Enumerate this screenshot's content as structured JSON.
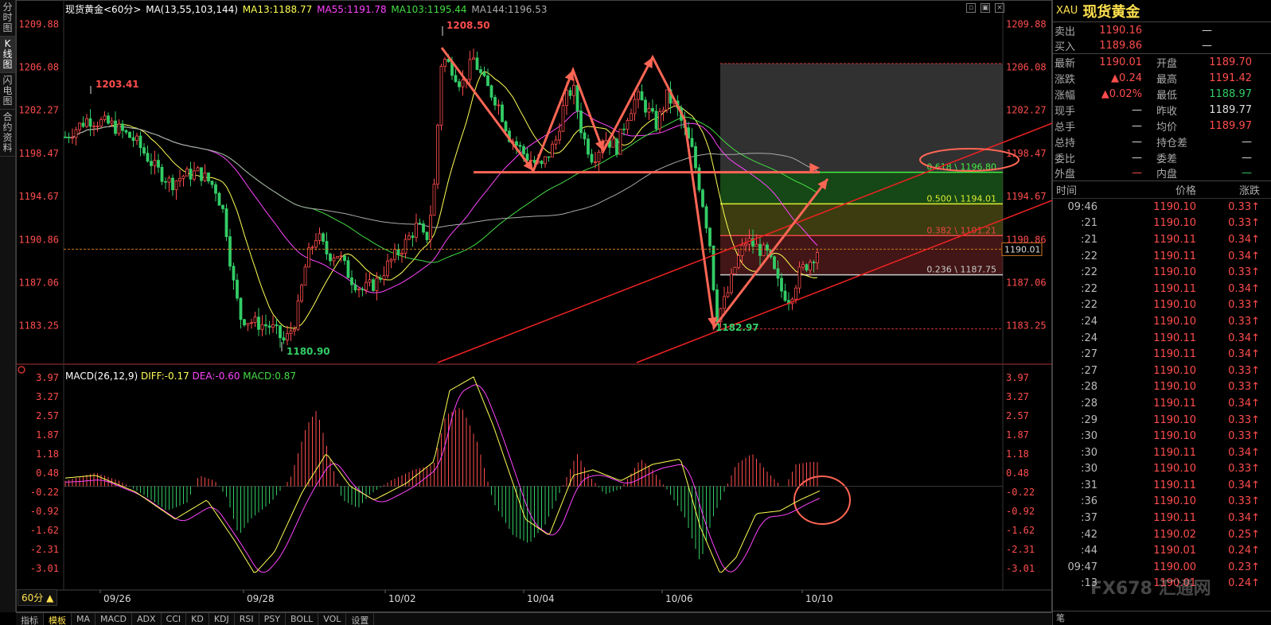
{
  "left_tabs": [
    "分时图",
    "K线图",
    "闪电图",
    "合约资料"
  ],
  "title": {
    "name": "现货黄金<60分>",
    "ma_label": "MA(13,55,103,144)",
    "ma13": "MA13:1188.77",
    "ma55": "MA55:1191.78",
    "ma103": "MA103:1195.44",
    "ma144": "MA144:1196.53"
  },
  "macd_title": {
    "label": "MACD(26,12,9)",
    "diff": "DIFF:-0.17",
    "dea": "DEA:-0.60",
    "macd": "MACD:0.87"
  },
  "price_axis": [
    "1209.88",
    "1206.08",
    "1202.27",
    "1198.47",
    "1194.67",
    "1190.86",
    "1187.06",
    "1183.25"
  ],
  "macd_axis": [
    "3.97",
    "3.27",
    "2.57",
    "1.87",
    "1.18",
    "0.48",
    "-0.22",
    "-0.92",
    "-1.62",
    "-2.31",
    "-3.01"
  ],
  "date_labels": [
    "09/26",
    "09/28",
    "10/02",
    "10/04",
    "10/06",
    "10/10"
  ],
  "annotations": {
    "high": "1208.50",
    "left_high": "1203.41",
    "low": "1180.90",
    "recent_low": "1182.97",
    "current_price": "1190.01"
  },
  "fib_levels": [
    {
      "label": "0.618 \\ 1196.80",
      "price": 1196.8
    },
    {
      "label": "0.500 \\ 1194.01",
      "price": 1194.01
    },
    {
      "label": "0.382 \\ 1191.21",
      "price": 1191.21
    },
    {
      "label": "0.236 \\ 1187.75",
      "price": 1187.75
    }
  ],
  "period": "60分 ▲",
  "bottom_tabs": [
    "指标",
    "模板",
    "MA",
    "MACD",
    "ADX",
    "CCI",
    "KD",
    "KDJ",
    "RSI",
    "PSY",
    "BOLL",
    "VOL",
    "设置"
  ],
  "colors": {
    "up": "#ff4d4d",
    "down": "#33cc66",
    "ma13": "#ffff55",
    "ma55": "#ff44ff",
    "ma103": "#44dd44",
    "ma144": "#aaaaaa",
    "accent": "#ffe14d"
  },
  "quote": {
    "code": "XAU",
    "name": "现货黄金",
    "sell_label": "卖出",
    "sell": "1190.16",
    "sell_vol": "—",
    "buy_label": "买入",
    "buy": "1189.86",
    "buy_vol": "—",
    "rows": [
      {
        "l1": "最新",
        "v1": "1190.01",
        "c1": "up",
        "l2": "开盘",
        "v2": "1189.70",
        "c2": "up"
      },
      {
        "l1": "涨跌",
        "v1": "▲0.24",
        "c1": "up",
        "l2": "最高",
        "v2": "1191.42",
        "c2": "up"
      },
      {
        "l1": "涨幅",
        "v1": "▲0.02%",
        "c1": "up",
        "l2": "最低",
        "v2": "1188.97",
        "c2": "dn"
      },
      {
        "l1": "现手",
        "v1": "—",
        "c1": "wh",
        "l2": "昨收",
        "v2": "1189.77",
        "c2": "wh"
      },
      {
        "l1": "总手",
        "v1": "—",
        "c1": "wh",
        "l2": "均价",
        "v2": "1189.97",
        "c2": "up"
      },
      {
        "l1": "总持",
        "v1": "—",
        "c1": "wh",
        "l2": "持仓差",
        "v2": "—",
        "c2": "wh"
      },
      {
        "l1": "委比",
        "v1": "—",
        "c1": "wh",
        "l2": "委差",
        "v2": "—",
        "c2": "wh"
      },
      {
        "l1": "外盘",
        "v1": "—",
        "c1": "up",
        "l2": "内盘",
        "v2": "—",
        "c2": "dn"
      }
    ]
  },
  "ticks_head": {
    "time": "时间",
    "price": "价格",
    "change": "涨跌"
  },
  "ticks": [
    {
      "t": "09:46",
      "p": "1190.10",
      "c": "0.33↑"
    },
    {
      "t": ":21",
      "p": "1190.10",
      "c": "0.33↑"
    },
    {
      "t": ":21",
      "p": "1190.11",
      "c": "0.34↑"
    },
    {
      "t": ":22",
      "p": "1190.11",
      "c": "0.34↑"
    },
    {
      "t": ":22",
      "p": "1190.10",
      "c": "0.33↑"
    },
    {
      "t": ":22",
      "p": "1190.11",
      "c": "0.34↑"
    },
    {
      "t": ":22",
      "p": "1190.10",
      "c": "0.33↑"
    },
    {
      "t": ":24",
      "p": "1190.10",
      "c": "0.33↑"
    },
    {
      "t": ":24",
      "p": "1190.11",
      "c": "0.34↑"
    },
    {
      "t": ":27",
      "p": "1190.11",
      "c": "0.34↑"
    },
    {
      "t": ":27",
      "p": "1190.10",
      "c": "0.33↑"
    },
    {
      "t": ":28",
      "p": "1190.10",
      "c": "0.33↑"
    },
    {
      "t": ":28",
      "p": "1190.11",
      "c": "0.34↑"
    },
    {
      "t": ":29",
      "p": "1190.10",
      "c": "0.33↑"
    },
    {
      "t": ":30",
      "p": "1190.10",
      "c": "0.33↑"
    },
    {
      "t": ":30",
      "p": "1190.11",
      "c": "0.34↑"
    },
    {
      "t": ":30",
      "p": "1190.10",
      "c": "0.33↑"
    },
    {
      "t": ":31",
      "p": "1190.11",
      "c": "0.34↑"
    },
    {
      "t": ":36",
      "p": "1190.10",
      "c": "0.33↑"
    },
    {
      "t": ":37",
      "p": "1190.11",
      "c": "0.34↑"
    },
    {
      "t": ":42",
      "p": "1190.02",
      "c": "0.25↑"
    },
    {
      "t": ":44",
      "p": "1190.01",
      "c": "0.24↑"
    },
    {
      "t": "09:47",
      "p": "1190.00",
      "c": "0.23↑"
    },
    {
      "t": ":13",
      "p": "1190.01",
      "c": "0.24↑"
    }
  ],
  "rp_bottom": "笔",
  "watermark": "FX678 汇通网"
}
